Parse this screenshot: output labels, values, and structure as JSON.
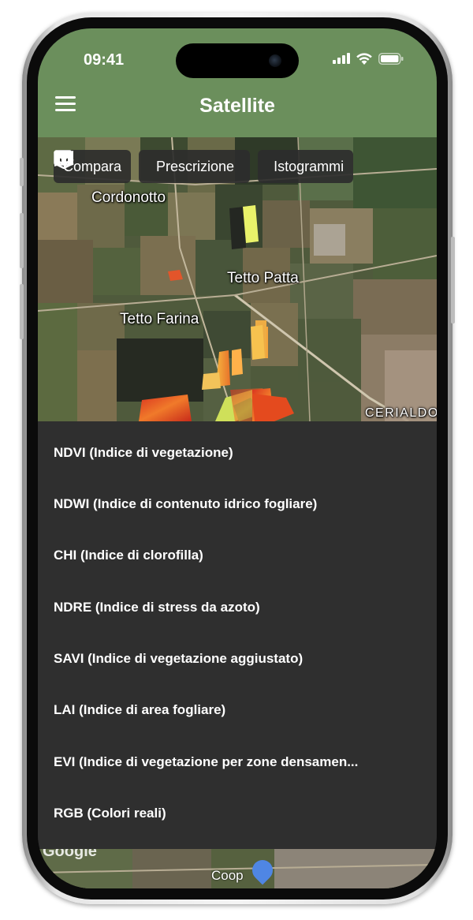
{
  "status_bar": {
    "time": "09:41"
  },
  "header": {
    "title": "Satellite"
  },
  "toolbar": {
    "buttons": [
      {
        "label": "Compara",
        "icon": "split-view-icon"
      },
      {
        "label": "Prescrizione",
        "icon": "layers-icon"
      },
      {
        "label": "Istogrammi",
        "icon": "map-icon"
      }
    ]
  },
  "map": {
    "places": [
      "Cordonotto",
      "Tetto Patta",
      "Tetto Farina",
      "CERIALDO"
    ],
    "bottom_labels": {
      "attribution": "Google",
      "poi": "Coop"
    }
  },
  "index_menu": {
    "items": [
      "NDVI (Indice di vegetazione)",
      "NDWI (Indice di contenuto idrico fogliare)",
      "CHI (Indice di clorofilla)",
      "NDRE (Indice di stress da azoto)",
      "SAVI (Indice di vegetazione aggiustato)",
      "LAI (Indice di area fogliare)",
      "EVI (Indice di vegetazione per zone densamen...",
      "RGB (Colori reali)"
    ]
  },
  "colors": {
    "header_green": "#6b8f5c",
    "menu_background": "#2f2f2f",
    "button_background": "#2d2d2d"
  }
}
